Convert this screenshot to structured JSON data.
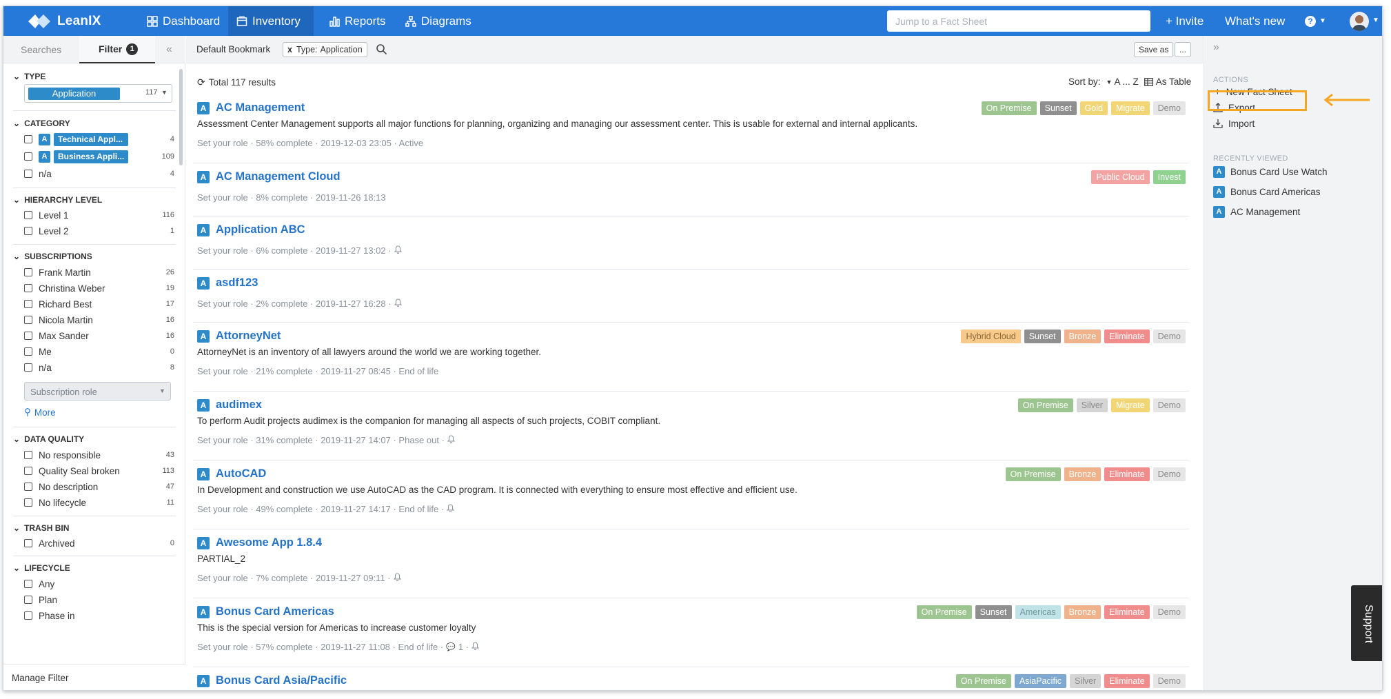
{
  "app": {
    "logo_text": "LeanIX"
  },
  "nav": [
    {
      "label": "Dashboard",
      "icon": "grid-icon"
    },
    {
      "label": "Inventory",
      "icon": "inventory-icon"
    },
    {
      "label": "Reports",
      "icon": "bar-chart-icon"
    },
    {
      "label": "Diagrams",
      "icon": "diagram-icon"
    }
  ],
  "search": {
    "placeholder": "Jump to a Fact Sheet"
  },
  "top_right": {
    "invite": "+ Invite",
    "whats_new": "What's new",
    "help": "?"
  },
  "left": {
    "tab_searches": "Searches",
    "tab_filter": "Filter",
    "filter_count": "1",
    "collapse": "«",
    "type": {
      "heading": "TYPE",
      "value": "Application",
      "count": "117"
    },
    "category": {
      "heading": "CATEGORY",
      "items": [
        {
          "label": "Technical Appl...",
          "count": "4",
          "badge": "A"
        },
        {
          "label": "Business Appli...",
          "count": "109",
          "badge": "A"
        },
        {
          "label": "n/a",
          "count": "4"
        }
      ]
    },
    "hierarchy": {
      "heading": "HIERARCHY LEVEL",
      "items": [
        {
          "label": "Level 1",
          "count": "116"
        },
        {
          "label": "Level 2",
          "count": "1"
        }
      ]
    },
    "subscriptions": {
      "heading": "SUBSCRIPTIONS",
      "items": [
        {
          "label": "Frank Martin",
          "count": "26"
        },
        {
          "label": "Christina Weber",
          "count": "19"
        },
        {
          "label": "Richard Best",
          "count": "17"
        },
        {
          "label": "Nicola Martin",
          "count": "16"
        },
        {
          "label": "Max Sander",
          "count": "16"
        },
        {
          "label": "Me",
          "count": "0"
        },
        {
          "label": "n/a",
          "count": "8"
        }
      ],
      "role_placeholder": "Subscription role",
      "more": "More"
    },
    "data_quality": {
      "heading": "DATA QUALITY",
      "items": [
        {
          "label": "No responsible",
          "count": "43"
        },
        {
          "label": "Quality Seal broken",
          "count": "113"
        },
        {
          "label": "No description",
          "count": "47"
        },
        {
          "label": "No lifecycle",
          "count": "11"
        }
      ]
    },
    "trash": {
      "heading": "TRASH BIN",
      "items": [
        {
          "label": "Archived",
          "count": "0"
        }
      ]
    },
    "lifecycle": {
      "heading": "LIFECYCLE",
      "items": [
        {
          "label": "Any"
        },
        {
          "label": "Plan"
        },
        {
          "label": "Phase in"
        }
      ]
    },
    "manage": "Manage Filter"
  },
  "main": {
    "bookmark": "Default Bookmark",
    "filter_chip": {
      "x": "x",
      "key": "Type:",
      "value": "Application"
    },
    "save_as": "Save as",
    "more_btn": "...",
    "total": "Total 117 results",
    "sort_label": "Sort by:",
    "sort_value": "A ... Z",
    "view": "As Table",
    "items": [
      {
        "title": "AC Management",
        "desc": "Assessment Center Management supports all major functions for planning, organizing and managing our assessment center. This is usable for external and internal applicants.",
        "meta": "Set your role · 58% complete · 2019-12-03 23:05 · Active",
        "bell": false,
        "comment": "",
        "tags": [
          {
            "t": "On Premise",
            "c": "#9cc58f"
          },
          {
            "t": "Sunset",
            "c": "#8f8f8f"
          },
          {
            "t": "Gold",
            "c": "#f2d675"
          },
          {
            "t": "Migrate",
            "c": "#f2d675"
          },
          {
            "t": "Demo",
            "c": "#e6e6e6",
            "dark": true
          }
        ]
      },
      {
        "title": "AC Management Cloud",
        "desc": "",
        "meta": "Set your role · 8% complete · 2019-11-26 18:13",
        "bell": false,
        "comment": "",
        "tags": [
          {
            "t": "Public Cloud",
            "c": "#f4a3a3"
          },
          {
            "t": "Invest",
            "c": "#8fd18f"
          }
        ]
      },
      {
        "title": "Application ABC",
        "desc": "",
        "meta": "Set your role · 6% complete · 2019-11-27 13:02 ·",
        "bell": true,
        "comment": "",
        "tags": []
      },
      {
        "title": "asdf123",
        "desc": "",
        "meta": "Set your role · 2% complete · 2019-11-27 16:28 ·",
        "bell": true,
        "comment": "",
        "tags": []
      },
      {
        "title": "AttorneyNet",
        "desc": "AttorneyNet is an inventory of all lawyers around the world we are working together.",
        "meta": "Set your role · 21% complete · 2019-11-27 08:45 · End of life",
        "bell": false,
        "comment": "",
        "tags": [
          {
            "t": "Hybrid Cloud",
            "c": "#f7c98a",
            "dark2": true
          },
          {
            "t": "Sunset",
            "c": "#8f8f8f"
          },
          {
            "t": "Bronze",
            "c": "#efb28b"
          },
          {
            "t": "Eliminate",
            "c": "#f08c8c"
          },
          {
            "t": "Demo",
            "c": "#e6e6e6",
            "dark": true
          }
        ]
      },
      {
        "title": "audimex",
        "desc": "To perform Audit projects audimex is the companion for managing all aspects of such projects, COBIT compliant.",
        "meta": "Set your role · 31% complete · 2019-11-27 14:07 · Phase out ·",
        "bell": true,
        "comment": "",
        "tags": [
          {
            "t": "On Premise",
            "c": "#9cc58f"
          },
          {
            "t": "Silver",
            "c": "#d5d5d5",
            "dark": true
          },
          {
            "t": "Migrate",
            "c": "#f2d675"
          },
          {
            "t": "Demo",
            "c": "#e6e6e6",
            "dark": true
          }
        ]
      },
      {
        "title": "AutoCAD",
        "desc": "In Development and construction we use AutoCAD as the CAD program. It is connected with everything to ensure most effective and efficient use.",
        "meta": "Set your role · 49% complete · 2019-11-27 14:17 · End of life ·",
        "bell": true,
        "comment": "",
        "tags": [
          {
            "t": "On Premise",
            "c": "#9cc58f"
          },
          {
            "t": "Bronze",
            "c": "#efb28b"
          },
          {
            "t": "Eliminate",
            "c": "#f08c8c"
          },
          {
            "t": "Demo",
            "c": "#e6e6e6",
            "dark": true
          }
        ]
      },
      {
        "title": "Awesome App 1.8.4",
        "desc": "PARTIAL_2",
        "meta": "Set your role · 7% complete · 2019-11-27 09:11 ·",
        "bell": true,
        "comment": "",
        "tags": []
      },
      {
        "title": "Bonus Card Americas",
        "desc": "This is the special version for Americas to increase customer loyalty",
        "meta": "Set your role · 57% complete · 2019-11-27 11:08 · End of life ·",
        "bell": true,
        "comment": "1 ·",
        "tags": [
          {
            "t": "On Premise",
            "c": "#9cc58f"
          },
          {
            "t": "Sunset",
            "c": "#8f8f8f"
          },
          {
            "t": "Americas",
            "c": "#bfe3e6",
            "dark3": true
          },
          {
            "t": "Bronze",
            "c": "#efb28b"
          },
          {
            "t": "Eliminate",
            "c": "#f08c8c"
          },
          {
            "t": "Demo",
            "c": "#e6e6e6",
            "dark": true
          }
        ]
      },
      {
        "title": "Bonus Card Asia/Pacific",
        "desc": "",
        "meta": "",
        "bell": false,
        "comment": "",
        "tags": [
          {
            "t": "On Premise",
            "c": "#9cc58f"
          },
          {
            "t": "AsiaPacific",
            "c": "#7ea8cf"
          },
          {
            "t": "Silver",
            "c": "#d5d5d5",
            "dark": true
          },
          {
            "t": "Eliminate",
            "c": "#f08c8c"
          },
          {
            "t": "Demo",
            "c": "#e6e6e6",
            "dark": true
          }
        ]
      }
    ]
  },
  "right": {
    "expand": "»",
    "actions_heading": "ACTIONS",
    "actions": [
      {
        "label": "New Fact Sheet",
        "icon": "plus-icon"
      },
      {
        "label": "Export",
        "icon": "export-icon"
      },
      {
        "label": "Import",
        "icon": "import-icon"
      }
    ],
    "recent_heading": "RECENTLY VIEWED",
    "recent": [
      {
        "label": "Bonus Card Use Watch",
        "badge": "A"
      },
      {
        "label": "Bonus Card Americas",
        "badge": "A"
      },
      {
        "label": "AC Management",
        "badge": "A"
      }
    ]
  },
  "support": "Support",
  "colors": {
    "brand": "#2679d8",
    "highlight": "#f5a623",
    "badge_blue": "#2e8bc9"
  }
}
